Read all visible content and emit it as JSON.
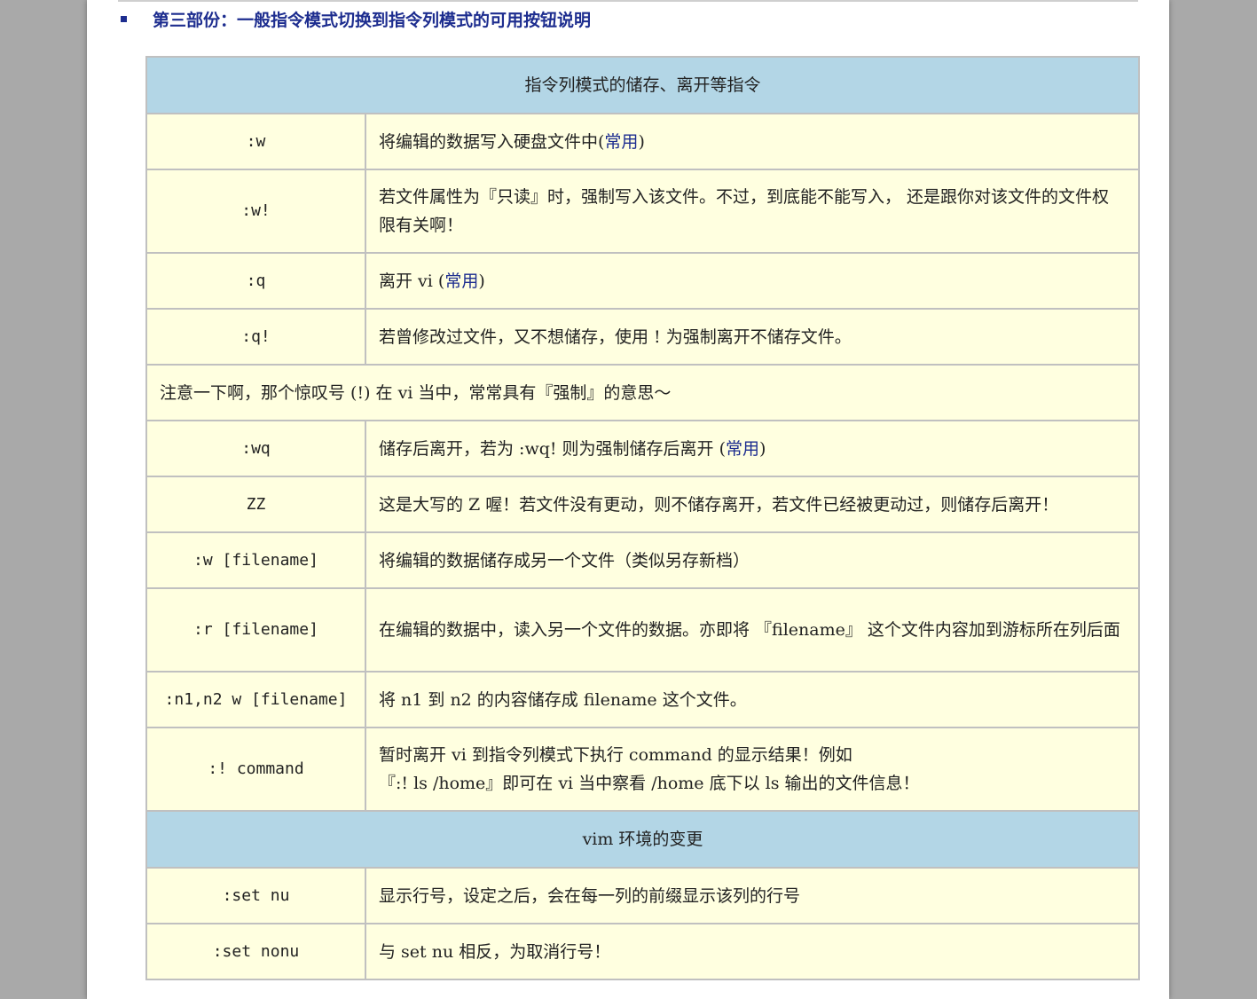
{
  "heading": "第三部份：一般指令模式切换到指令列模式的可用按钮说明",
  "section1_header": "指令列模式的储存、离开等指令",
  "rows1": [
    {
      "key": ":w",
      "desc": "将编辑的数据写入硬盘文件中(",
      "hl": "常用",
      "tail": ")"
    },
    {
      "key": ":w!",
      "desc": "若文件属性为『只读』时，强制写入该文件。不过，到底能不能写入， 还是跟你对该文件的文件权限有关啊！"
    },
    {
      "key": ":q",
      "desc": "离开 vi (",
      "hl": "常用",
      "tail": ")"
    },
    {
      "key": ":q!",
      "desc": "若曾修改过文件，又不想储存，使用 ! 为强制离开不储存文件。"
    }
  ],
  "note": "注意一下啊，那个惊叹号 (!) 在 vi 当中，常常具有『强制』的意思～",
  "rows2": [
    {
      "key": ":wq",
      "desc": "储存后离开，若为 :wq! 则为强制储存后离开 (",
      "hl": "常用",
      "tail": ")"
    },
    {
      "key": "ZZ",
      "desc": "这是大写的 Z 喔！若文件没有更动，则不储存离开，若文件已经被更动过，则储存后离开！"
    },
    {
      "key": ":w [filename]",
      "desc": "将编辑的数据储存成另一个文件（类似另存新档）"
    },
    {
      "key": ":r [filename]",
      "desc": "在编辑的数据中，读入另一个文件的数据。亦即将 『filename』 这个文件内容加到游标所在列后面"
    },
    {
      "key": ":n1,n2 w [filename]",
      "desc": "将 n1 到 n2 的内容储存成 filename 这个文件。"
    },
    {
      "key": ":! command",
      "desc": "暂时离开 vi 到指令列模式下执行 command 的显示结果！例如",
      "desc2": "『:! ls /home』即可在 vi 当中察看 /home 底下以 ls 输出的文件信息！"
    }
  ],
  "section2_header": "vim 环境的变更",
  "rows3": [
    {
      "key": ":set nu",
      "desc": "显示行号，设定之后，会在每一列的前缀显示该列的行号"
    },
    {
      "key": ":set nonu",
      "desc": "与 set nu 相反，为取消行号！"
    }
  ]
}
